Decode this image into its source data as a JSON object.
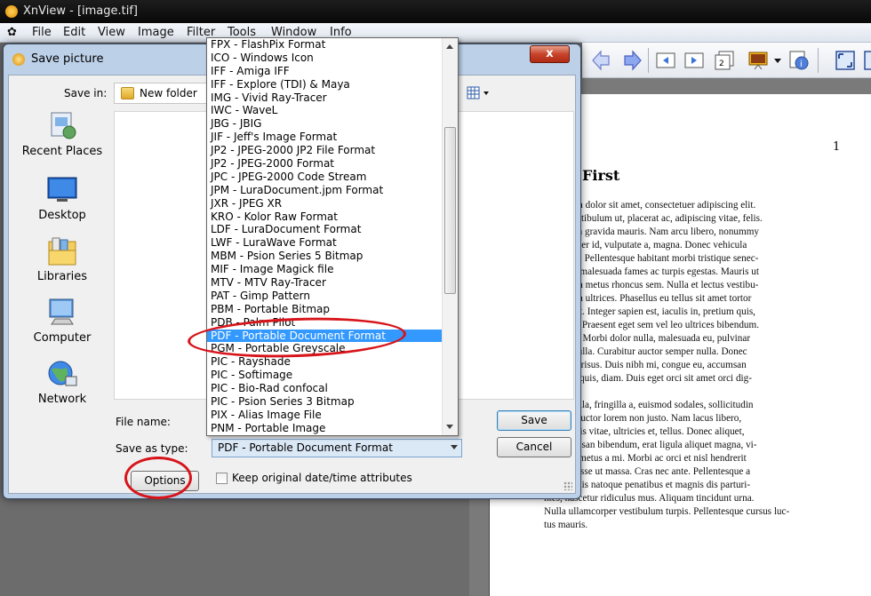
{
  "app": {
    "title": "XnView - [image.tif]",
    "menu": [
      "File",
      "Edit",
      "View",
      "Image",
      "Filter",
      "Tools",
      "Window",
      "Info"
    ]
  },
  "dialog": {
    "title": "Save picture",
    "close_label": "x",
    "save_in_label": "Save in:",
    "folder": "New folder",
    "places": [
      "Recent Places",
      "Desktop",
      "Libraries",
      "Computer",
      "Network"
    ],
    "file_name_label": "File name:",
    "save_as_type_label": "Save as type:",
    "save_as_type_value": "PDF - Portable Document Format",
    "save_label": "Save",
    "cancel_label": "Cancel",
    "options_label": "Options",
    "keep_attrs_label": "Keep original date/time attributes",
    "keep_attrs_checked": false
  },
  "format_list": {
    "selected_index": 22,
    "items": [
      "FPX - FlashPix Format",
      "ICO - Windows Icon",
      "IFF - Amiga IFF",
      "IFF - Explore (TDI) & Maya",
      "IMG - Vivid Ray-Tracer",
      "IWC - WaveL",
      "JBG - JBIG",
      "JIF - Jeff's Image Format",
      "JP2 - JPEG-2000 JP2 File Format",
      "JP2 - JPEG-2000 Format",
      "JPC - JPEG-2000 Code Stream",
      "JPM - LuraDocument.jpm Format",
      "JXR - JPEG XR",
      "KRO - Kolor Raw Format",
      "LDF - LuraDocument Format",
      "LWF - LuraWave Format",
      "MBM - Psion Series 5 Bitmap",
      "MIF - Image Magick file",
      "MTV - MTV Ray-Tracer",
      "PAT - Gimp Pattern",
      "PBM - Portable Bitmap",
      "PDB - Palm Pilot",
      "PDF - Portable Document Format",
      "PGM - Portable Greyscale",
      "PIC - Rayshade",
      "PIC - Softimage",
      "PIC - Bio-Rad confocal",
      "PIC - Psion Series 3 Bitmap",
      "PIX - Alias Image File",
      "PNM - Portable Image"
    ]
  },
  "document": {
    "page_number": "1",
    "section_title": "First",
    "paragraph1": "em ipsum dolor sit amet, consectetuer adipiscing elit.\ns elit, vestibulum ut, placerat ac, adipiscing vitae, felis.\nur dictum gravida mauris. Nam arcu libero, nonummy\nonsectetuer id, vulputate a, magna. Donec vehicula\neu neque. Pellentesque habitant morbi tristique senec-\nmetus et malesuada fames ac turpis egestas. Mauris ut\nas viverra metus rhoncus sem. Nulla et lectus vestibu-\na fringilla ultrices. Phasellus eu tellus sit amet tortor\na placerat. Integer sapien est, iaculis in, pretium quis,\nac, nunc. Praesent eget sem vel leo ultrices bibendum.\nfaucibus. Morbi dolor nulla, malesuada eu, pulvinar\nllis ac, nulla. Curabitur auctor semper nulla. Donec\norci eget risus. Duis nibh mi, congue eu, accumsan\n, sagittis quis, diam. Duis eget orci sit amet orci dig-\nrutrum.",
    "paragraph2": "n dui ligula, fringilla a, euismod sodales, sollicitudin\n. Morbi auctor lorem non justo. Nam lacus libero,\nat, lobortis vitae, ultricies et, tellus. Donec aliquet,\ned accumsan bibendum, erat ligula aliquet magna, vi-\nare odio metus a mi. Morbi ac orci et nisl hendrerit\nSuspendisse ut massa. Cras nec ante. Pellentesque a\nCum sociis natoque penatibus et magnis dis parturi-\nntes, nascetur ridiculus mus. Aliquam tincidunt urna.\nNulla ullamcorper vestibulum turpis. Pellentesque cursus luc-\ntus mauris."
  },
  "colors": {
    "selection": "#3399ff",
    "annotation": "#d7141a"
  }
}
